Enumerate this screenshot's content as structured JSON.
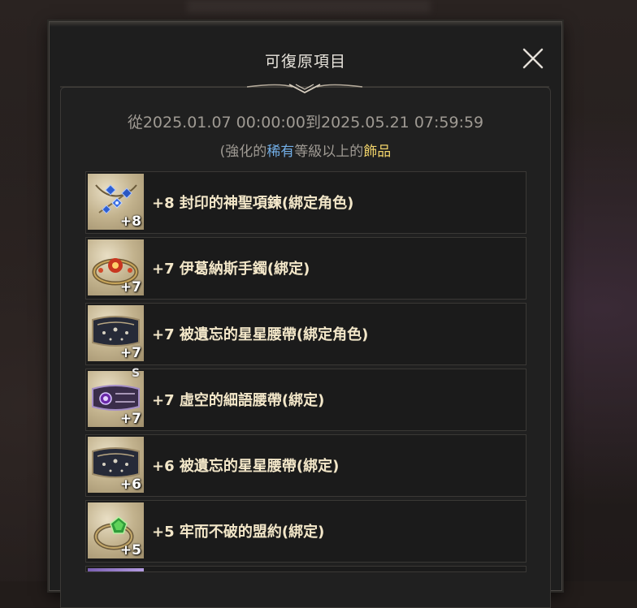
{
  "dialog": {
    "title": "可復原項目",
    "close_icon": "close-x-icon",
    "date_range": "從2025.01.07 00:00:00到2025.05.21 07:59:59",
    "subtitle": {
      "open": "(強化的",
      "rarity": "稀有",
      "middle": "等級以上的",
      "category": "飾品"
    }
  },
  "colors": {
    "rarity": "#72aee6",
    "category": "#f1d36a",
    "item_name": "#f3e7c9",
    "panel_bg": "#202020"
  },
  "items": [
    {
      "name": "+8 封印的神聖項鍊(綁定角色)",
      "enhance": "+8",
      "icon": "sacred-necklace-icon",
      "mark": ""
    },
    {
      "name": "+7 伊葛納斯手鐲(綁定)",
      "enhance": "+7",
      "icon": "ignis-bracelet-icon",
      "mark": ""
    },
    {
      "name": "+7 被遺忘的星星腰帶(綁定角色)",
      "enhance": "+7",
      "icon": "forgotten-star-belt-icon",
      "mark": ""
    },
    {
      "name": "+7 虛空的細語腰帶(綁定)",
      "enhance": "+7",
      "icon": "void-whisper-belt-icon",
      "mark": "S"
    },
    {
      "name": "+6 被遺忘的星星腰帶(綁定)",
      "enhance": "+6",
      "icon": "forgotten-star-belt-icon",
      "mark": ""
    },
    {
      "name": "+5 牢而不破的盟約(綁定)",
      "enhance": "+5",
      "icon": "unbreakable-covenant-ring-icon",
      "mark": ""
    }
  ]
}
